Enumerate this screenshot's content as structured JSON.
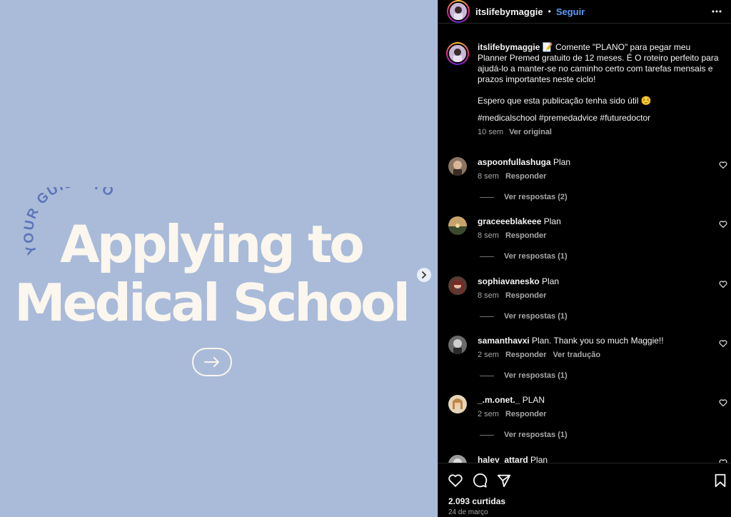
{
  "media": {
    "arc_text": "YOUR GUIDE TO",
    "headline_line1": "Applying to",
    "headline_line2": "Medical School",
    "background_color": "#a9bbd9",
    "next_icon": "chevron-right-icon",
    "cta_icon": "arrow-right-icon"
  },
  "header": {
    "username": "itslifebymaggie",
    "separator": "•",
    "follow_label": "Seguir",
    "more_icon": "more-horizontal-icon"
  },
  "caption": {
    "username": "itslifebymaggie",
    "text": "📝 Comente \"PLANO\" para pegar meu Planner Premed gratuito de 12 meses. É O roteiro perfeito para ajudá-lo a manter-se no caminho certo com tarefas mensais e prazos importantes neste ciclo!",
    "text2": "Espero que esta publicação tenha sido útil ☺️",
    "hashtags": "#medicalschool #premedadvice #futuredoctor",
    "time": "10 sem",
    "see_original": "Ver original"
  },
  "comments": [
    {
      "username": "aspoonfullashuga",
      "text": "Plan",
      "time": "8 sem",
      "reply": "Responder",
      "translate": "",
      "replies": "Ver respostas (2)"
    },
    {
      "username": "graceeeblakeee",
      "text": "Plan",
      "time": "8 sem",
      "reply": "Responder",
      "translate": "",
      "replies": "Ver respostas (1)"
    },
    {
      "username": "sophiavanesko",
      "text": "Plan",
      "time": "8 sem",
      "reply": "Responder",
      "translate": "",
      "replies": "Ver respostas (1)"
    },
    {
      "username": "samanthavxi",
      "text": "Plan. Thank you so much Maggie!!",
      "time": "2 sem",
      "reply": "Responder",
      "translate": "Ver tradução",
      "replies": "Ver respostas (1)"
    },
    {
      "username": "_.m.onet._",
      "text": "PLAN",
      "time": "2 sem",
      "reply": "Responder",
      "translate": "",
      "replies": "Ver respostas (1)"
    },
    {
      "username": "haley_attard",
      "text": "Plan",
      "time": "",
      "reply": "",
      "translate": "",
      "replies": ""
    }
  ],
  "actions": {
    "like_icon": "heart-icon",
    "comment_icon": "comment-icon",
    "share_icon": "send-icon",
    "save_icon": "bookmark-icon",
    "likes": "2.093 curtidas",
    "date": "24 de março"
  },
  "colors": {
    "link_blue": "#5a9cf8",
    "hashtag_blue": "#8eabf5",
    "muted": "#a8a8a8",
    "headline": "#fbf6ee",
    "arc_text": "#5c74b8"
  }
}
